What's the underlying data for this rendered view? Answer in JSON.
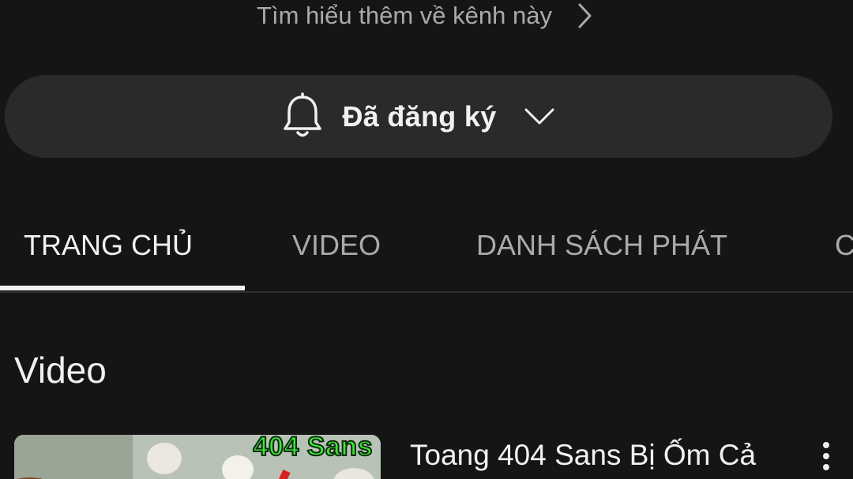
{
  "channel": {
    "learn_more_text": "Tìm hiểu thêm về kênh này",
    "learn_more_icon": "chevron-right-icon"
  },
  "subscribe": {
    "label": "Đã đăng ký",
    "bell_icon": "bell-icon",
    "dropdown_icon": "chevron-down-icon"
  },
  "tabs": [
    {
      "label": "TRANG CHỦ",
      "active": true
    },
    {
      "label": "VIDEO",
      "active": false
    },
    {
      "label": "DANH SÁCH PHÁT",
      "active": false
    },
    {
      "label": "C",
      "active": false
    }
  ],
  "section": {
    "title": "Video"
  },
  "video": {
    "thumbnail_text": "404 Sans",
    "title": "Toang 404 Sans Bị Ốm Cả",
    "more_icon": "more-vert-icon"
  },
  "colors": {
    "background": "#151515",
    "button_bg": "#2a2a2a",
    "text_primary": "#f1f1f1",
    "text_secondary": "#aaaaaa",
    "thumbnail_accent": "#3ce83a"
  }
}
